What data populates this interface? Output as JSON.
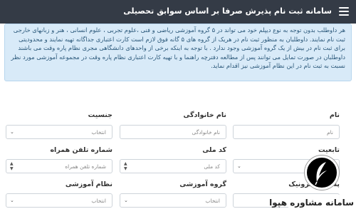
{
  "header": {
    "title": "سامانه ثبت نام پذیرش صرفا بر اساس سوابق تحصیلی"
  },
  "info": {
    "lines": [
      "هر داوطلب بدون توجه به نوع دیپلم خود می تواند در ۵ گروه آموزشی ریاضی و فنی ،علوم تجربی ، علوم انسانی ، هنر و زبانهای خارجی",
      "ثبت نام نمایند. داوطلبان به منظور ثبت نام در هریک از گروه های ۵ گانه فوق لازم است کارت اعتباری جداگانه تهیه نمایند و محدودیتی",
      "برای ثبت نام در بیش از یک گروه آموزشی وجود ندارد . با توجه به اینکه برخی از واحدهای دانشگاهی مجری نظام پاره وقت می باشند",
      "داوطلبان در صورت تمایل می توانند پس از مطالعه دفترچه راهنما و با تهیه کارت اعتباری نظام پاره وقت در مجموعه آموزشی مورد نظر",
      "نسبت به ثبت نام در این نظام آموزشی نیز اقدام نماید."
    ]
  },
  "form": {
    "first_name": {
      "label": "نام",
      "placeholder": "نام"
    },
    "last_name": {
      "label": "نام خانوادگی",
      "placeholder": "نام خانوادگی"
    },
    "gender": {
      "label": "جنسیت",
      "value": "انتخاب"
    },
    "nationality": {
      "label": "تابعیت"
    },
    "national_code": {
      "label": "کد ملی",
      "placeholder": "کد ملی"
    },
    "mobile": {
      "label": "شماره تلفن همراه",
      "placeholder": "شماره تلفن همراه"
    },
    "email": {
      "label": "پست الکترونیک"
    },
    "study_group": {
      "label": "گروه آموزشی",
      "value": "انتخاب"
    },
    "education_system": {
      "label": "نظام آموزشی",
      "value": "انتخاب"
    }
  },
  "brand": {
    "wordmark": "سامانه مشاوره هپوا"
  }
}
